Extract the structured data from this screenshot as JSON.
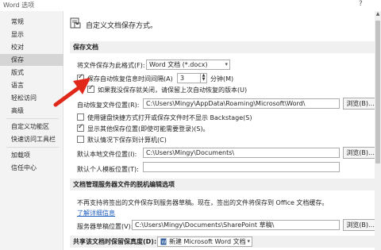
{
  "window": {
    "title": "Word 选项",
    "help": "?"
  },
  "sidebar": {
    "items": [
      {
        "label": "常规"
      },
      {
        "label": "显示"
      },
      {
        "label": "校对"
      },
      {
        "label": "保存"
      },
      {
        "label": "版式"
      },
      {
        "label": "语言"
      },
      {
        "label": "轻松访问"
      },
      {
        "label": "高级"
      },
      {
        "label": "自定义功能区"
      },
      {
        "label": "快速访问工具栏"
      },
      {
        "label": "加载项"
      },
      {
        "label": "信任中心"
      }
    ],
    "active_index": 3
  },
  "main": {
    "header": "自定义文档保存方式。",
    "save_section": {
      "title": "保存文档",
      "format_label": "将文件保存为此格式(F):",
      "format_value": "Word 文档 (*.docx)",
      "autorecover_label": "保存自动恢复信息时间间隔(A)",
      "autorecover_minutes": "3",
      "minutes_label": "分钟(M)",
      "keep_last_label": "如果我没保存就关闭，请保留上次自动恢复的版本(U)",
      "autorecover_path_label": "自动恢复文件位置(R):",
      "autorecover_path": "C:\\Users\\Mingy\\AppData\\Roaming\\Microsoft\\Word\\",
      "browse1": "浏览(B)...",
      "no_backstage_label": "使用键盘快捷方式打开或保存文件时不显示 Backstage(S)",
      "show_more_places_label": "显示其他保存位置(即使可能需要登录)(S)。",
      "default_to_computer_label": "默认情况下保存到计算机(C)",
      "default_local_label": "默认本地文件位置(I):",
      "default_local_path": "C:\\Users\\Mingy\\Documents\\",
      "browse2": "浏览(B)...",
      "personal_templates_label": "默认个人模板位置(T):",
      "personal_templates_path": ""
    },
    "server_section": {
      "title": "文档管理服务器文件的脱机编辑选项",
      "notice": "不再支持将签出的文件保存到服务器草稿。现在，签出的文件将保存到 Office 文档缓存。",
      "learn_more": "了解详细信息",
      "drafts_label": "服务器草稿位置(V):",
      "drafts_path": "C:\\Users\\Mingy\\Documents\\SharePoint 草稿\\",
      "browse3": "浏览(B)..."
    },
    "fidelity": {
      "label": "共享该文档时保留保真度(D):",
      "doc_value": "新建 Microsoft Word 文档"
    }
  },
  "checkbox_states": {
    "autorecover": true,
    "keep_last": true,
    "no_backstage": false,
    "show_more_places": true,
    "default_to_computer": false
  },
  "colors": {
    "sidebar_bg": "#f3f3f3",
    "active_item_bg": "#d5d5d5",
    "section_head_bg": "#f0f0f0",
    "link": "#1f5fbf",
    "arrow": "#e0291b"
  }
}
